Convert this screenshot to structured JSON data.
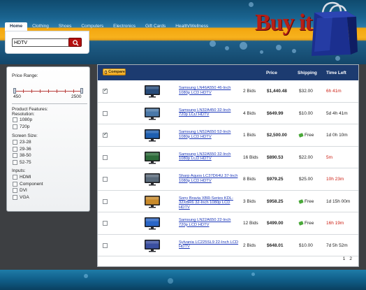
{
  "brand": {
    "logo_text": "Buy it",
    "accent": "#b61f16",
    "header_blue": "#1a6490",
    "header_orange": "#f7b21d"
  },
  "nav": {
    "tabs": [
      {
        "label": "Home",
        "active": true
      },
      {
        "label": "Clothing",
        "active": false
      },
      {
        "label": "Shoes",
        "active": false
      },
      {
        "label": "Computers",
        "active": false
      },
      {
        "label": "Electronics",
        "active": false
      },
      {
        "label": "Gift Cards",
        "active": false
      },
      {
        "label": "Health/Wellness",
        "active": false
      }
    ]
  },
  "search": {
    "value": "HDTV",
    "button_icon": "search-icon"
  },
  "filters": {
    "price_range": {
      "label": "Price Range:",
      "min_label": "450",
      "max_label": "2500"
    },
    "product_features": {
      "label": "Product Features:",
      "resolution_label": "Resolution:",
      "resolution": [
        {
          "label": "1080p",
          "checked": false
        },
        {
          "label": "720p",
          "checked": false
        }
      ]
    },
    "screen_size": {
      "label": "Screen Size:",
      "options": [
        {
          "label": "23-28",
          "checked": false
        },
        {
          "label": "29-36",
          "checked": false
        },
        {
          "label": "38-50",
          "checked": false
        },
        {
          "label": "52-75",
          "checked": false
        }
      ]
    },
    "inputs": {
      "label": "Inputs:",
      "options": [
        {
          "label": "HDMI",
          "checked": false
        },
        {
          "label": "Component",
          "checked": false
        },
        {
          "label": "DVI",
          "checked": false
        },
        {
          "label": "VGA",
          "checked": false
        }
      ]
    }
  },
  "results": {
    "compare_label": "Compare",
    "columns": {
      "price": "Price",
      "shipping": "Shipping",
      "time_left": "Time Left"
    },
    "rows": [
      {
        "name": "Samsung LN46A550 46-Inch 1080p LCD HDTV",
        "bids": "2 Bids",
        "price": "$1,440.48",
        "shipping": "$32.00",
        "free": false,
        "time": "6h 41m",
        "time_urgent": true,
        "checked": true,
        "icon": "tv-icon"
      },
      {
        "name": "Samsung LN32A450 32-Inch 720p LCD HDTV",
        "bids": "4 Bids",
        "price": "$649.99",
        "shipping": "$10.00",
        "free": false,
        "time": "5d 4h 41m",
        "time_urgent": false,
        "checked": false,
        "icon": "tv-icon"
      },
      {
        "name": "Samsung LN52A650 52-Inch 1080p LCD HDTV",
        "bids": "1 Bids",
        "price": "$2,500.00",
        "shipping": "Free",
        "free": true,
        "time": "1d 0h 10m",
        "time_urgent": false,
        "checked": true,
        "icon": "tv-icon"
      },
      {
        "name": "Samsung LN32A550 32-Inch 1080p LCD HDTV",
        "bids": "16 Bids",
        "price": "$890.53",
        "shipping": "$22.00",
        "free": false,
        "time": "5m",
        "time_urgent": true,
        "checked": false,
        "icon": "tv-icon"
      },
      {
        "name": "Sharp Aquos LC37D64U 37-Inch 1080p LCD HDTV",
        "bids": "8 Bids",
        "price": "$979.25",
        "shipping": "$25.00",
        "free": false,
        "time": "10h 23m",
        "time_urgent": true,
        "checked": false,
        "icon": "tv-icon"
      },
      {
        "name": "Sony Bravia XBR-Series KDL-32XBR6 32-Inch 1080p LCD HDTV",
        "bids": "3 Bids",
        "price": "$958.25",
        "shipping": "Free",
        "free": true,
        "time": "1d 15h 00m",
        "time_urgent": false,
        "checked": false,
        "icon": "tv-icon"
      },
      {
        "name": "Samsung LN22A650 22-Inch 720p LCD HDTV",
        "bids": "12 Bids",
        "price": "$499.00",
        "shipping": "Free",
        "free": true,
        "time": "16h 19m",
        "time_urgent": true,
        "checked": false,
        "icon": "tv-icon"
      },
      {
        "name": "Sylvania LC225SL9 22-Inch LCD HDTV",
        "bids": "2 Bids",
        "price": "$648.01",
        "shipping": "$10.00",
        "free": false,
        "time": "7d 5h 52m",
        "time_urgent": false,
        "checked": false,
        "icon": "tv-icon"
      }
    ],
    "pages": [
      "1",
      "2"
    ],
    "urgent_color": "#cc1e12"
  }
}
